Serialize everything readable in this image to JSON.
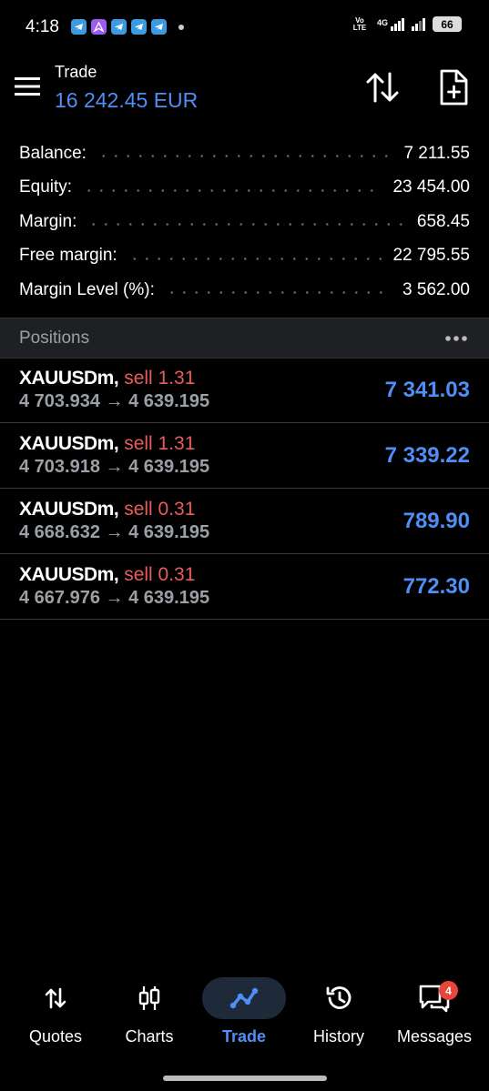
{
  "status_bar": {
    "time": "4:18",
    "network": "4G",
    "volte": "Vo LTE",
    "battery": "66",
    "notification_icons": [
      "telegram-icon",
      "app-icon",
      "telegram-icon",
      "telegram-icon",
      "telegram-icon"
    ]
  },
  "header": {
    "title": "Trade",
    "balance": "16 242.45 EUR",
    "accent_color": "#4f8ef5"
  },
  "summary": [
    {
      "label": "Balance:",
      "value": "7 211.55"
    },
    {
      "label": "Equity:",
      "value": "23 454.00"
    },
    {
      "label": "Margin:",
      "value": "658.45"
    },
    {
      "label": "Free margin:",
      "value": "22 795.55"
    },
    {
      "label": "Margin Level (%):",
      "value": "3 562.00"
    }
  ],
  "positions": {
    "title": "Positions",
    "items": [
      {
        "symbol": "XAUUSDm,",
        "type": "sell 1.31",
        "prices": "4 703.934 → 4 639.195",
        "profit": "7 341.03"
      },
      {
        "symbol": "XAUUSDm,",
        "type": "sell 1.31",
        "prices": "4 703.918 → 4 639.195",
        "profit": "7 339.22"
      },
      {
        "symbol": "XAUUSDm,",
        "type": "sell 0.31",
        "prices": "4 668.632 → 4 639.195",
        "profit": "789.90"
      },
      {
        "symbol": "XAUUSDm,",
        "type": "sell 0.31",
        "prices": "4 667.976 → 4 639.195",
        "profit": "772.30"
      }
    ],
    "sell_color": "#e85c5c",
    "profit_color": "#4f8ef5"
  },
  "nav": {
    "items": [
      {
        "label": "Quotes",
        "icon": "quotes-icon"
      },
      {
        "label": "Charts",
        "icon": "charts-icon"
      },
      {
        "label": "Trade",
        "icon": "trade-icon",
        "active": true
      },
      {
        "label": "History",
        "icon": "history-icon"
      },
      {
        "label": "Messages",
        "icon": "messages-icon",
        "badge": "4"
      }
    ]
  }
}
